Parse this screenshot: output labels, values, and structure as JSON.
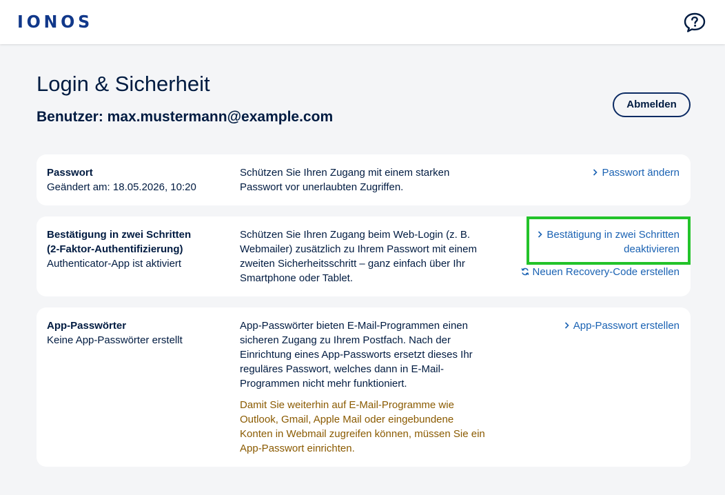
{
  "header": {
    "logo": "IONOS",
    "help_icon": "help-chat-icon"
  },
  "page": {
    "title": "Login & Sicherheit",
    "user_line": "Benutzer: max.mustermann@example.com",
    "logout_label": "Abmelden"
  },
  "cards": {
    "password": {
      "title": "Passwort",
      "subtitle": "Geändert am: 18.05.2026, 10:20",
      "description": "Schützen Sie Ihren Zugang mit einem starken Passwort vor unerlaubten Zugriffen.",
      "action": "Passwort ändern"
    },
    "two_factor": {
      "title_line1": "Bestätigung in zwei Schritten",
      "title_line2": "(2-Faktor-Authentifizierung)",
      "subtitle": "Authenticator-App ist aktiviert",
      "description": "Schützen Sie Ihren Zugang beim Web-Login (z. B. Webmailer) zusätzlich zu Ihrem Passwort mit einem zweiten Sicherheitsschritt – ganz einfach über Ihr Smartphone oder Tablet.",
      "action_line1": "Bestätigung in zwei Schritten",
      "action_line2": "deaktivieren",
      "recovery_action": "Neuen Recovery-Code erstellen"
    },
    "app_passwords": {
      "title": "App-Passwörter",
      "subtitle": "Keine App-Passwörter erstellt",
      "description": "App-Passwörter bieten E-Mail-Programmen einen sicheren Zugang zu Ihrem Postfach. Nach der Einrichtung eines App-Passworts ersetzt dieses Ihr reguläres Passwort, welches dann in E-Mail-Programmen nicht mehr funktioniert.",
      "notice": "Damit Sie weiterhin auf E-Mail-Programme wie Outlook, Gmail, Apple Mail oder eingebundene Konten in Webmail zugreifen können, müssen Sie ein App-Passwort einrichten.",
      "action": "App-Passwort erstellen"
    }
  },
  "colors": {
    "brand": "#11388a",
    "link": "#1a62b3",
    "warning_text": "#8a5a00",
    "highlight": "#23c32a",
    "background": "#f4f5f7"
  }
}
